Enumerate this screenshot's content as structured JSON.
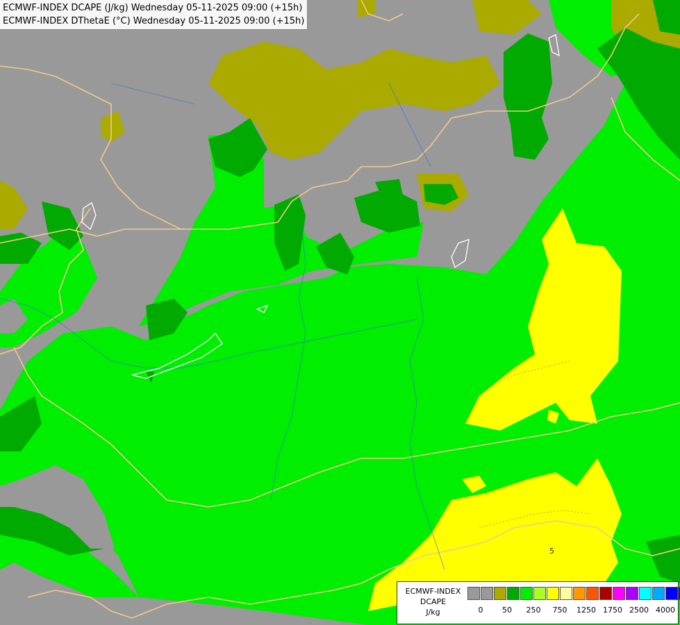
{
  "header": {
    "line1": "ECMWF-INDEX DCAPE (J/kg) Wednesday 05-11-2025 09:00 (+15h)",
    "line2": "ECMWF-INDEX DThetaE (°C) Wednesday 05-11-2025 09:00 (+15h)"
  },
  "map": {
    "contour_label": "5"
  },
  "legend": {
    "line1": "ECMWF-INDEX",
    "line2": "DCAPE",
    "line3": "J/kg",
    "colors": [
      "#999999",
      "#999999",
      "#aaaa00",
      "#00aa00",
      "#00ee00",
      "#aaff22",
      "#ffff00",
      "#ffff99",
      "#ff9900",
      "#ff5500",
      "#aa0000",
      "#ff00ff",
      "#aa00ff",
      "#00ffff",
      "#00aaff",
      "#0000ff",
      "#000099"
    ],
    "ticks": [
      "0",
      "50",
      "250",
      "750",
      "1250",
      "1750",
      "2500",
      "4000"
    ]
  }
}
